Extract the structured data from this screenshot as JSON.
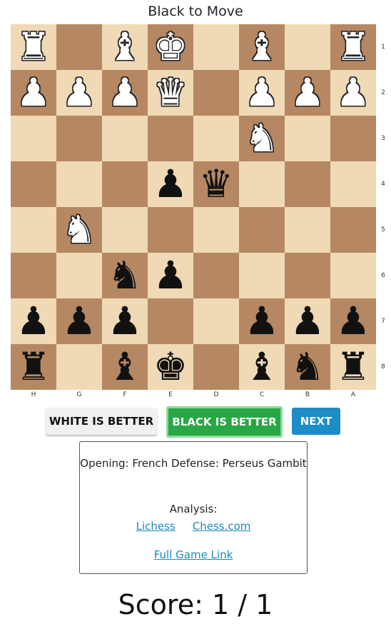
{
  "status": "Black to Move",
  "board": {
    "files": [
      "H",
      "G",
      "F",
      "E",
      "D",
      "C",
      "B",
      "A"
    ],
    "ranks": [
      "1",
      "2",
      "3",
      "4",
      "5",
      "6",
      "7",
      "8"
    ],
    "squares": [
      [
        "wR",
        "",
        "wB",
        "wK",
        "",
        "wB",
        "",
        "wR"
      ],
      [
        "wP",
        "wP",
        "wP",
        "wQ",
        "",
        "wP",
        "wP",
        "wP"
      ],
      [
        "",
        "",
        "",
        "",
        "",
        "wN",
        "",
        ""
      ],
      [
        "",
        "",
        "",
        "bP",
        "bQ",
        "",
        "",
        ""
      ],
      [
        "",
        "wN",
        "",
        "",
        "",
        "",
        "",
        ""
      ],
      [
        "",
        "",
        "bN",
        "bP",
        "",
        "",
        "",
        ""
      ],
      [
        "bP",
        "bP",
        "bP",
        "",
        "",
        "bP",
        "bP",
        "bP"
      ],
      [
        "bR",
        "",
        "bB",
        "bK",
        "",
        "bB",
        "bN",
        "bR"
      ]
    ],
    "colors": {
      "light": "#f0d9b5",
      "dark": "#b58863"
    }
  },
  "buttons": {
    "white_better": "WHITE IS BETTER",
    "black_better": "BLACK IS BETTER",
    "next": "NEXT"
  },
  "info": {
    "opening": "Opening: French Defense: Perseus Gambit",
    "analysis_label": "Analysis:",
    "lichess": "Lichess",
    "chesscom": "Chess.com",
    "full_game": "Full Game Link"
  },
  "score": "Score: 1 / 1"
}
